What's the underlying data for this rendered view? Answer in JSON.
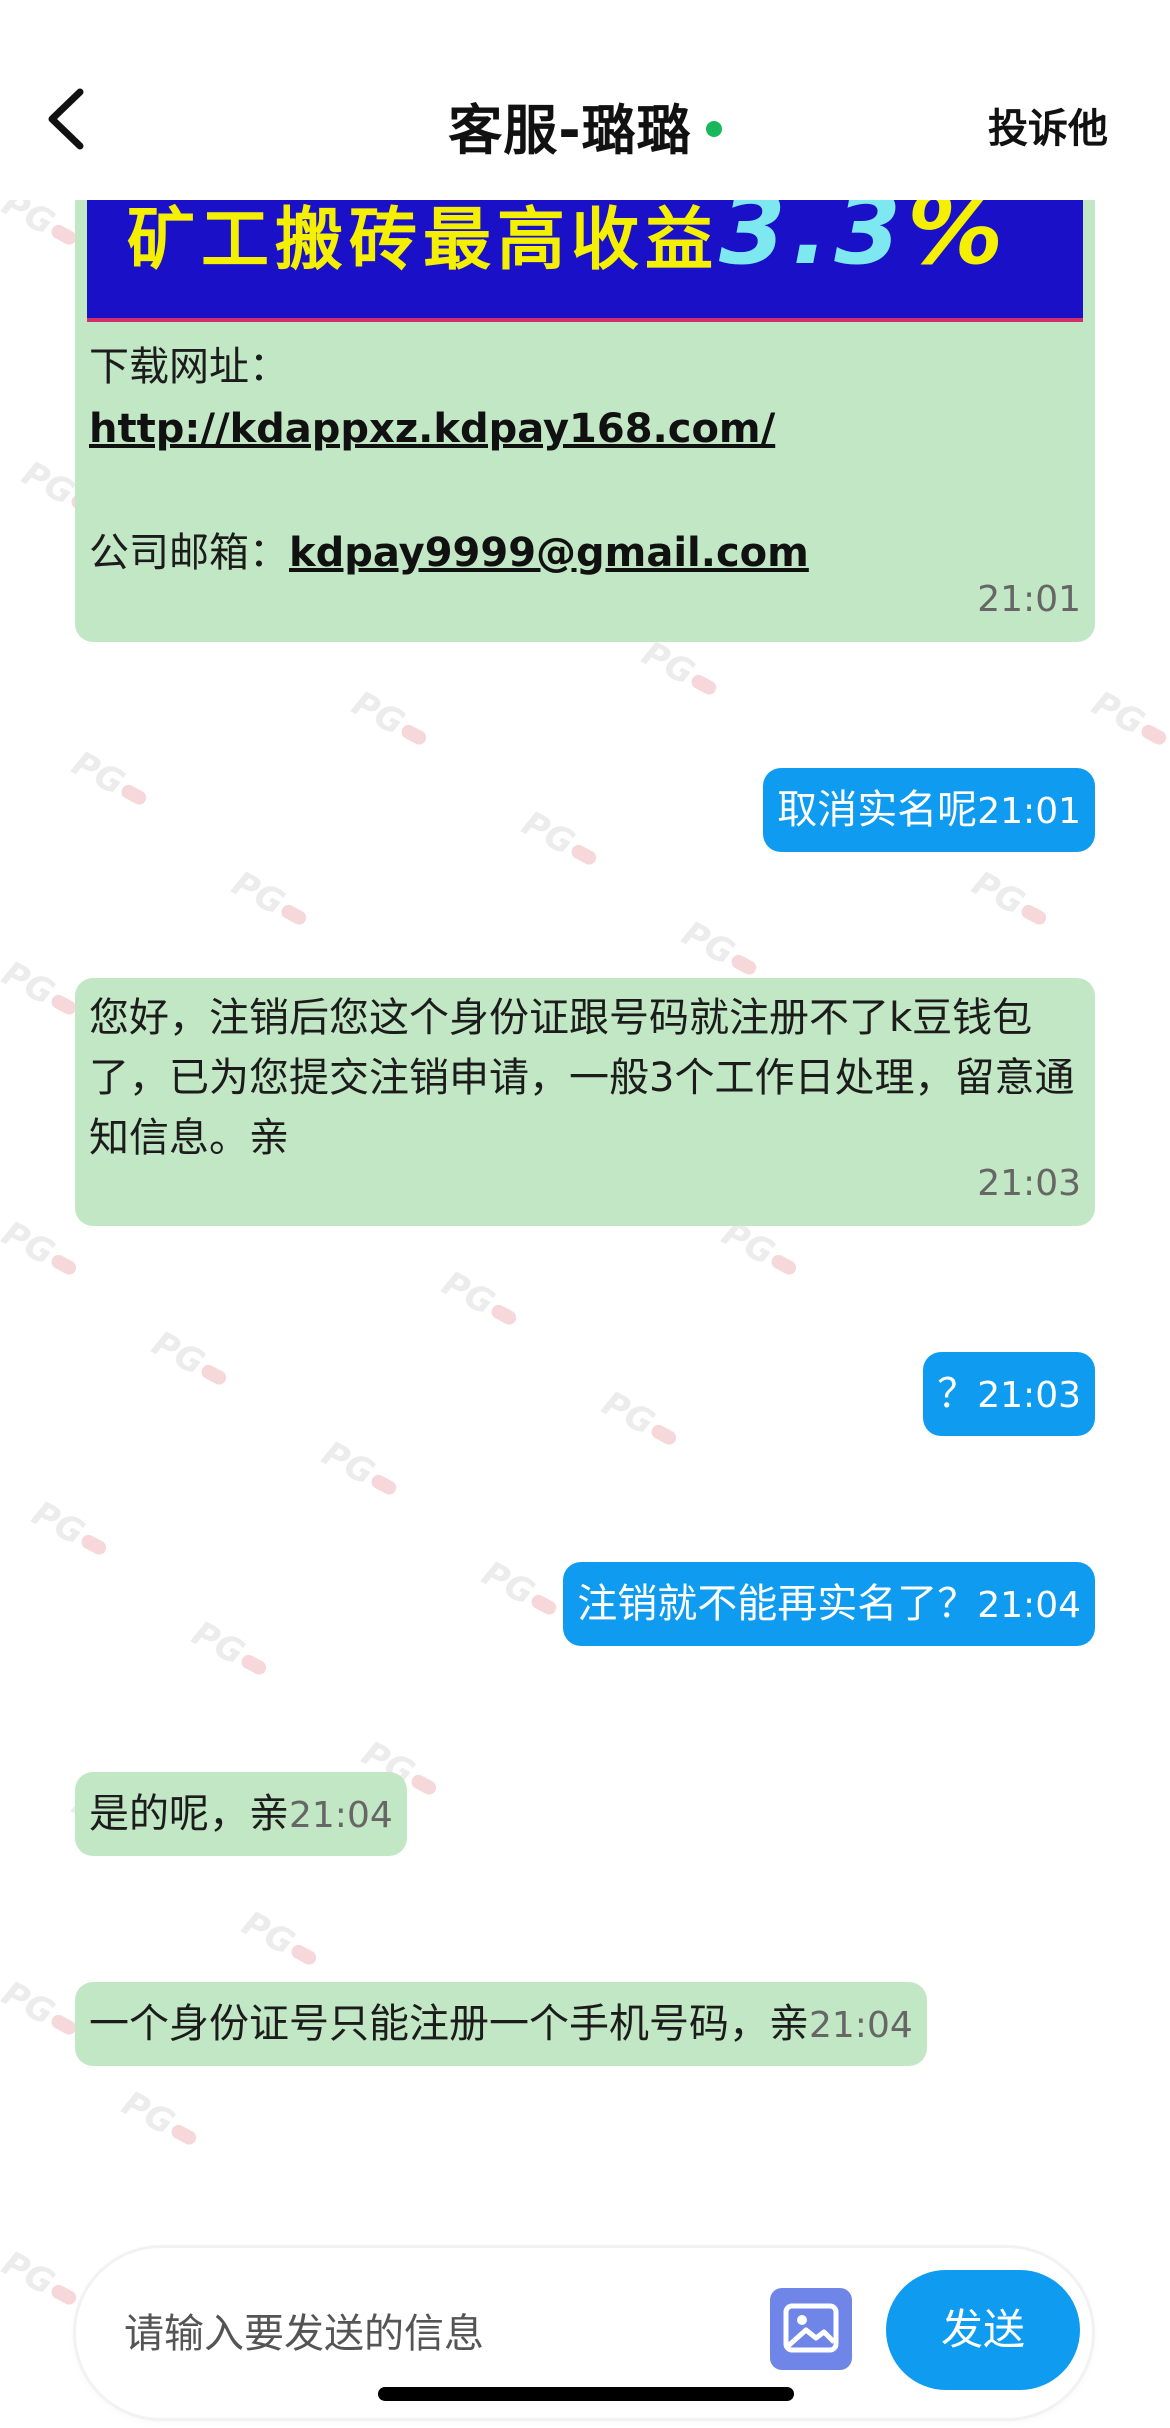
{
  "header": {
    "title": "客服-璐璐",
    "complain_label": "投诉他"
  },
  "watermark": "PG",
  "messages": {
    "first": {
      "banner_text": "矿工搬砖最高收益",
      "banner_number": "3.3",
      "banner_percent": "%",
      "download_label": "下载网址：",
      "download_link": "http://kdappxz.kdpay168.com/",
      "email_label": "公司邮箱：",
      "email_link": "kdpay9999@gmail.com",
      "time": "21:01"
    },
    "m2": {
      "text": "取消实名呢",
      "time": "21:01"
    },
    "m3": {
      "text": "您好，注销后您这个身份证跟号码就注册不了k豆钱包了，已为您提交注销申请，一般3个工作日处理，留意通知信息。亲",
      "time": "21:03"
    },
    "m4": {
      "text": "？",
      "time": "21:03"
    },
    "m5": {
      "text": "注销就不能再实名了？",
      "time": "21:04"
    },
    "m6": {
      "text": "是的呢，亲",
      "time": "21:04"
    },
    "m7": {
      "text": "一个身份证号只能注册一个手机号码，亲",
      "time": "21:04"
    }
  },
  "input": {
    "placeholder": "请输入要发送的信息",
    "send_label": "发送"
  },
  "colors": {
    "received_bubble": "#c2e7c5",
    "sent_bubble": "#0e9bf0",
    "online": "#18b85a"
  },
  "icons": {
    "back": "chevron-left-icon",
    "image": "image-icon"
  }
}
